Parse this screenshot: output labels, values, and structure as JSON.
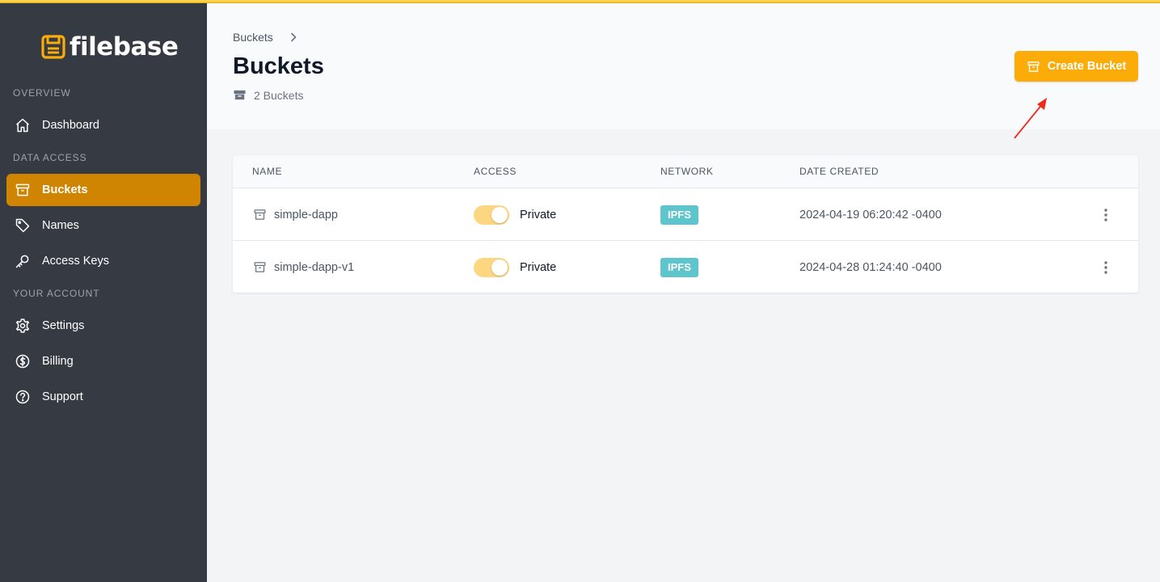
{
  "brand": {
    "name": "filebase",
    "accent": "#fbac09",
    "icon": "floppy-disk-icon"
  },
  "sidebar": {
    "sections": [
      {
        "label": "OVERVIEW"
      },
      {
        "label": "DATA ACCESS"
      },
      {
        "label": "YOUR ACCOUNT"
      }
    ],
    "items": [
      {
        "label": "Dashboard",
        "icon": "home-icon",
        "active": false
      },
      {
        "label": "Buckets",
        "icon": "archive-box-icon",
        "active": true
      },
      {
        "label": "Names",
        "icon": "tag-icon",
        "active": false
      },
      {
        "label": "Access Keys",
        "icon": "key-icon",
        "active": false
      },
      {
        "label": "Settings",
        "icon": "gear-icon",
        "active": false
      },
      {
        "label": "Billing",
        "icon": "dollar-circle-icon",
        "active": false
      },
      {
        "label": "Support",
        "icon": "question-circle-icon",
        "active": false
      }
    ]
  },
  "header": {
    "breadcrumb": "Buckets",
    "title": "Buckets",
    "count_text": "2 Buckets",
    "create_button": "Create Bucket"
  },
  "table": {
    "columns": [
      "NAME",
      "ACCESS",
      "NETWORK",
      "DATE CREATED"
    ],
    "rows": [
      {
        "name": "simple-dapp",
        "access": "Private",
        "network": "IPFS",
        "created": "2024-04-19 06:20:42 -0400"
      },
      {
        "name": "simple-dapp-v1",
        "access": "Private",
        "network": "IPFS",
        "created": "2024-04-28 01:24:40 -0400"
      }
    ]
  },
  "colors": {
    "sidebar_bg": "#363a43",
    "active_item": "#d08502",
    "badge": "#5fc5cc",
    "toggle_on": "#fcd680",
    "annotation_arrow": "#ef2b1f"
  }
}
